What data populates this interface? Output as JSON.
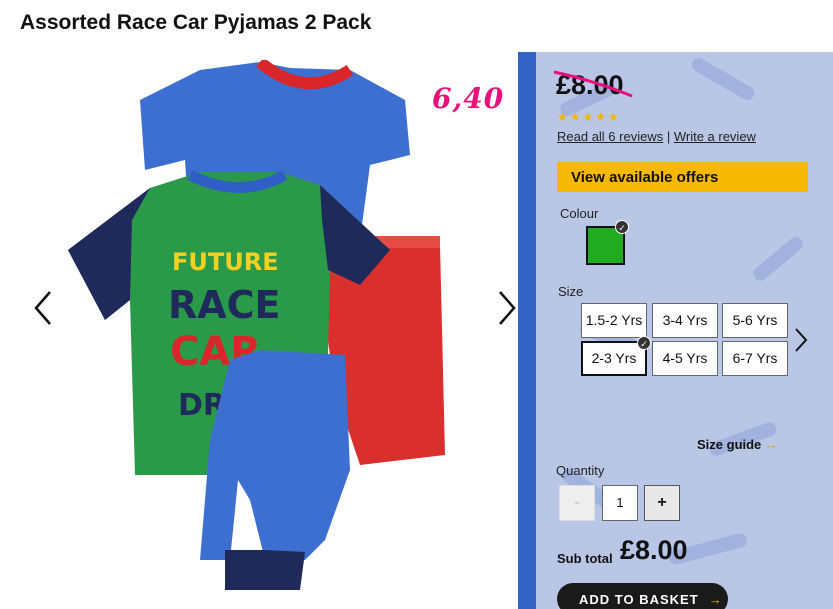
{
  "product": {
    "title": "Assorted Race Car Pyjamas 2 Pack",
    "old_price": "£8.00",
    "handwritten_price": "6,40",
    "rating_stars": "★★★★★",
    "rating_value": 5,
    "reviews_link": "Read all 6 reviews",
    "reviews_separator": " | ",
    "write_review_link": "Write a review",
    "offers_button": "View available offers",
    "tshirt_print": [
      "FUTURE",
      "RACE",
      "CAR",
      "DRIVER"
    ]
  },
  "colour": {
    "label": "Colour",
    "selected_swatch": "#22aa22"
  },
  "size": {
    "label": "Size",
    "options": [
      "1.5-2 Yrs",
      "3-4 Yrs",
      "5-6 Yrs",
      "2-3 Yrs",
      "4-5 Yrs",
      "6-7 Yrs"
    ],
    "selected": "2-3 Yrs",
    "guide_label": "Size guide",
    "guide_arrow": "→"
  },
  "quantity": {
    "label": "Quantity",
    "minus": "-",
    "value": "1",
    "plus": "+"
  },
  "subtotal": {
    "label": "Sub total",
    "value": "£8.00"
  },
  "basket": {
    "label": "ADD TO BASKET",
    "arrow": "→"
  },
  "colors": {
    "accent_yellow": "#f6b800",
    "handwriting_pink": "#e8107d",
    "panel_background": "#b9c6e6"
  },
  "icons": [
    "chevron-left-icon",
    "chevron-right-icon",
    "checkmark-icon",
    "star-icon",
    "arrow-right-icon"
  ]
}
